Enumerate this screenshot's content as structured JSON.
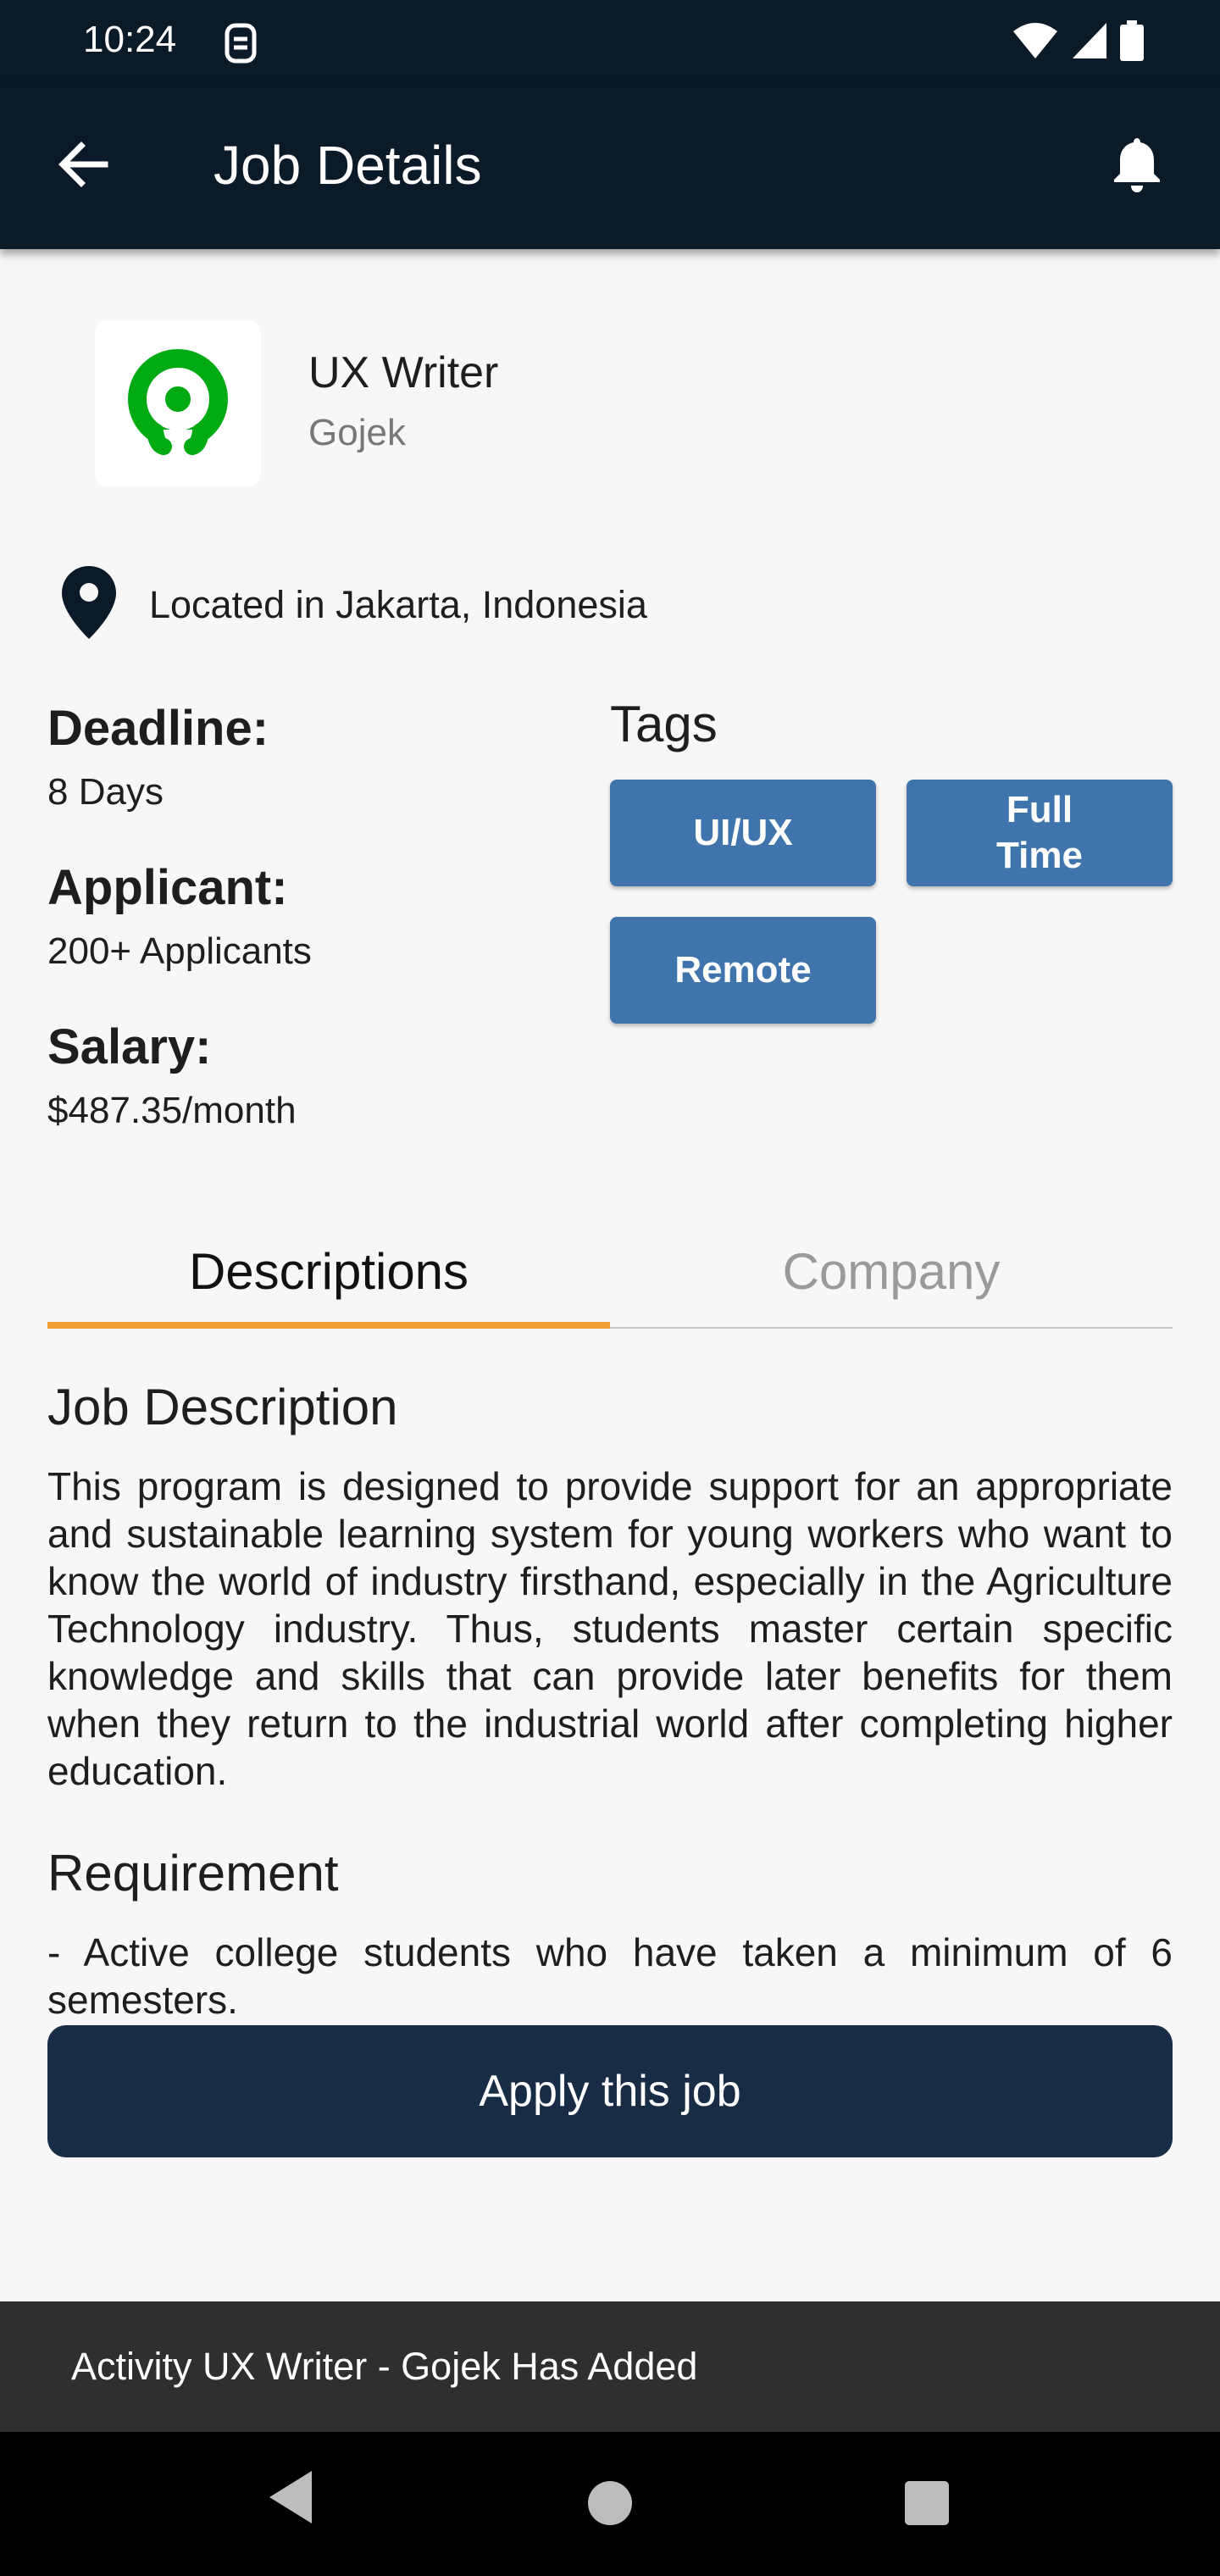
{
  "status_bar": {
    "time": "10:24"
  },
  "app_bar": {
    "title": "Job Details"
  },
  "job": {
    "title": "UX Writer",
    "company": "Gojek",
    "location": "Located in Jakarta, Indonesia"
  },
  "info": {
    "deadline_label": "Deadline:",
    "deadline_value": "8 Days",
    "applicant_label": "Applicant:",
    "applicant_value": "200+ Applicants",
    "salary_label": "Salary:",
    "salary_value": "$487.35/month"
  },
  "tags": {
    "title": "Tags",
    "items": [
      "UI/UX",
      "Full Time",
      "Remote"
    ]
  },
  "tabs": [
    {
      "label": "Descriptions",
      "selected": true
    },
    {
      "label": "Company",
      "selected": false
    }
  ],
  "description": {
    "title": "Job Description",
    "text": "This program is designed to provide support for an appropriate and sustainable learning system for young workers who want to know the world of industry firsthand, especially in the Agriculture Technology industry. Thus, students master certain specific knowledge and skills that can provide later benefits for them when they return to the industrial world after completing higher education."
  },
  "requirement": {
    "title": "Requirement",
    "text": "- Active college students who have taken a minimum of 6 semesters."
  },
  "apply_button": {
    "label": "Apply this job"
  },
  "snackbar": {
    "message": "Activity UX Writer - Gojek Has Added"
  },
  "colors": {
    "app_bar": "#0b1a28",
    "tag": "#3f74ad",
    "tab_indicator": "#f0a033",
    "apply_button": "#182c45",
    "gojek_green": "#00aa13"
  },
  "icons": [
    "back-arrow-icon",
    "bell-icon",
    "location-pin-icon",
    "gojek-logo",
    "wifi-icon",
    "signal-icon",
    "battery-icon"
  ]
}
